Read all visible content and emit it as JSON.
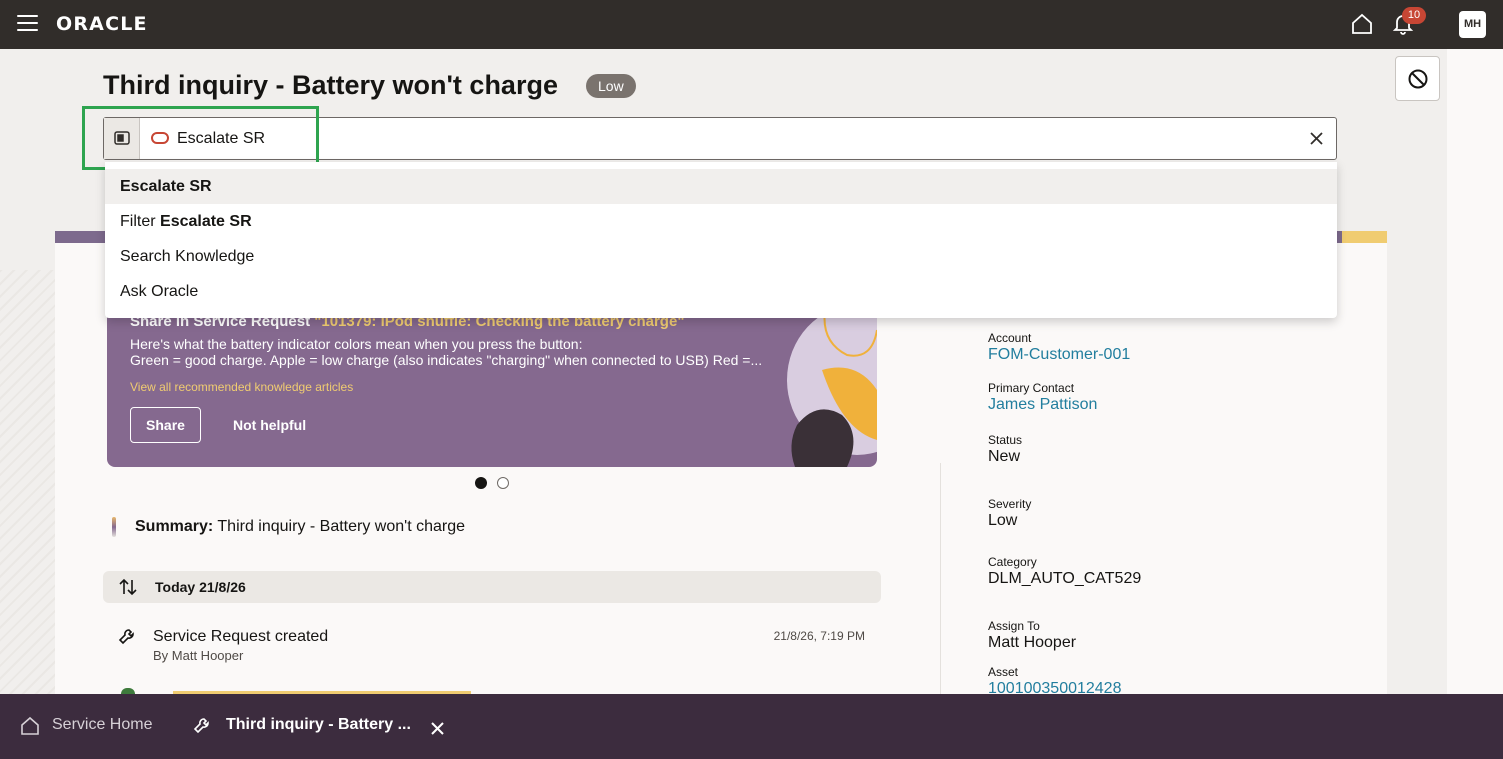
{
  "header": {
    "logo": "ORACLE",
    "notification_count": "10",
    "user_initials": "MH"
  },
  "page": {
    "title": "Third inquiry - Battery won't charge",
    "priority": "Low"
  },
  "command_bar": {
    "value": "Escalate SR",
    "suggestions": {
      "first": "Escalate SR",
      "filter_prefix": "Filter",
      "filter_term": "Escalate SR",
      "search_knowledge": "Search Knowledge",
      "ask_oracle": "Ask Oracle"
    }
  },
  "knowledge": {
    "title_prefix": "Share in Service Request",
    "title_article": "\"101379: iPod shuffle: Checking the battery charge\"",
    "line1": "Here's what the battery indicator colors mean when you press the button:",
    "line2": "Green = good charge. Apple = low charge (also indicates \"charging\" when connected to USB) Red =...",
    "link": "View all recommended knowledge articles",
    "share": "Share",
    "not_helpful": "Not helpful"
  },
  "summary": {
    "label": "Summary:",
    "text": "Third inquiry - Battery won't charge"
  },
  "timeline": {
    "date": "Today 21/8/26",
    "activity_title": "Service Request created",
    "activity_by": "By Matt Hooper",
    "activity_time": "21/8/26, 7:19 PM"
  },
  "details": {
    "account_label": "Account",
    "account_value": "FOM-Customer-001",
    "contact_label": "Primary Contact",
    "contact_value": "James Pattison",
    "status_label": "Status",
    "status_value": "New",
    "severity_label": "Severity",
    "severity_value": "Low",
    "category_label": "Category",
    "category_value": "DLM_AUTO_CAT529",
    "assign_label": "Assign To",
    "assign_value": "Matt Hooper",
    "asset_label": "Asset",
    "asset_value": "100100350012428"
  },
  "tabs": {
    "home": "Service Home",
    "current": "Third inquiry - Battery ..."
  },
  "colors": {
    "header_bg": "#312d2a",
    "tabbar_bg": "#3c2c3e",
    "accent_red": "#c74634",
    "link": "#227e9e",
    "knowledge_bg": "#85698f",
    "highlight": "#f0cc71",
    "focus_frame": "#2ea44f"
  }
}
